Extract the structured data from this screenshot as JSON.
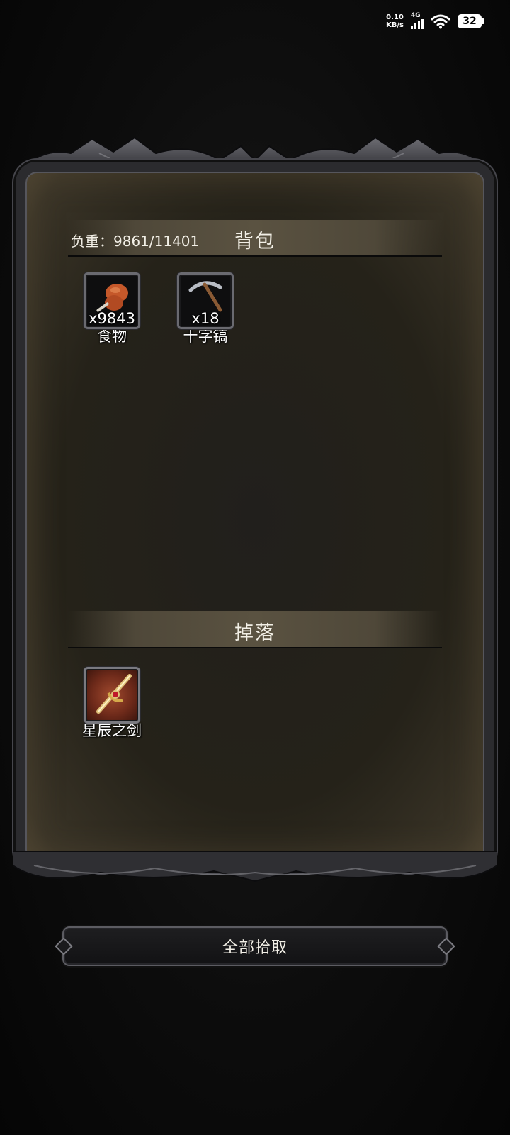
{
  "status_bar": {
    "net_speed_value": "0.10",
    "net_speed_unit": "KB/s",
    "network_type": "4G",
    "battery_level": "32"
  },
  "backpack": {
    "weight_label": "负重：9861/11401",
    "title": "背包",
    "items": [
      {
        "name": "食物",
        "quantity": "x9843",
        "icon": "roast-meat-icon"
      },
      {
        "name": "十字镐",
        "quantity": "x18",
        "icon": "pickaxe-icon"
      }
    ]
  },
  "drops": {
    "title": "掉落",
    "items": [
      {
        "name": "星辰之剑",
        "icon": "sword-icon"
      }
    ]
  },
  "actions": {
    "pickup_all_label": "全部拾取"
  },
  "colors": {
    "panel_bg": "#252219",
    "header_bg": "#5a5241",
    "frame": "#2b2b2e"
  }
}
